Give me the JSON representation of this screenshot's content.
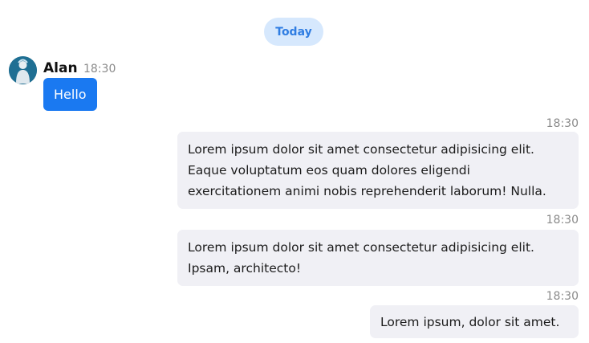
{
  "colors": {
    "accent": "#1a79f1",
    "badge_bg": "#d6e8fd",
    "badge_text": "#2f7de2",
    "outgoing_bubble": "#f0f0f5"
  },
  "day_separator": "Today",
  "incoming": {
    "sender": "Alan",
    "time": "18:30",
    "avatar_icon": "user-avatar-icon",
    "text": "Hello"
  },
  "outgoing": [
    {
      "time": "18:30",
      "text": "Lorem ipsum dolor sit amet consectetur adipisicing elit.\nEaque voluptatum eos quam dolores eligendi\nexercitationem animi nobis reprehenderit laborum! Nulla."
    },
    {
      "time": "18:30",
      "text": "Lorem ipsum dolor sit amet consectetur adipisicing elit.\nIpsam, architecto!"
    },
    {
      "time": "18:30",
      "text": "Lorem ipsum, dolor sit amet."
    }
  ]
}
